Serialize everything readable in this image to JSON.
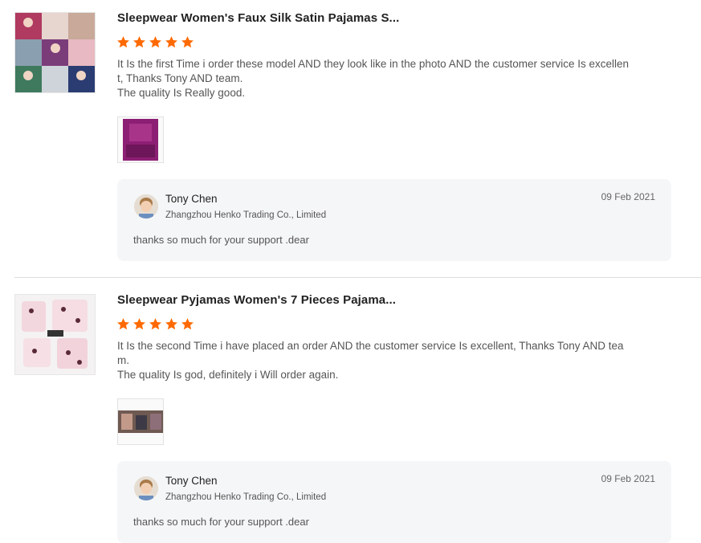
{
  "colors": {
    "star": "#ff6a00",
    "reply_bg": "#f5f6f8",
    "divider": "#dcdcdc"
  },
  "reviews": [
    {
      "product_title": "Sleepwear Women's Faux Silk Satin Pajamas S...",
      "rating": 5,
      "comment_lines": [
        "It Is the first Time i order these model AND they look like in the photo AND the customer service Is excellen",
        "t, Thanks Tony AND team.",
        "The quality Is Really good."
      ],
      "reply": {
        "seller_name": "Tony Chen",
        "company": "Zhangzhou Henko Trading Co., Limited",
        "date": "09 Feb 2021",
        "text": "thanks so much for your support .dear"
      }
    },
    {
      "product_title": "Sleepwear Pyjamas Women's 7 Pieces Pajama...",
      "rating": 5,
      "comment_lines": [
        "It Is the second Time i have placed an order AND the customer service Is excellent, Thanks Tony AND tea",
        "m.",
        "The quality Is god, definitely i Will order again."
      ],
      "reply": {
        "seller_name": "Tony Chen",
        "company": "Zhangzhou Henko Trading Co., Limited",
        "date": "09 Feb 2021",
        "text": "thanks so much for your support .dear"
      }
    }
  ]
}
